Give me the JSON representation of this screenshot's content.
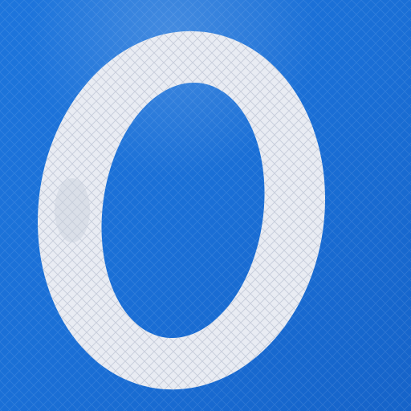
{
  "sign": {
    "glyph": "0",
    "colors": {
      "background": "#1a6fd6",
      "background_dark": "#0f58b8",
      "glyph": "#e9ecf3",
      "glyph_shadow": "#d3d9e4",
      "retroreflective_pattern": "#ffffff"
    }
  }
}
